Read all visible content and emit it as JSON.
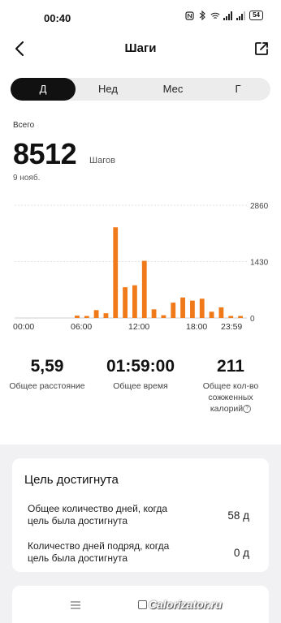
{
  "status_bar": {
    "time": "00:40",
    "battery": "54"
  },
  "header": {
    "title": "Шаги"
  },
  "tabs": [
    {
      "label": "Д",
      "active": true
    },
    {
      "label": "Нед",
      "active": false
    },
    {
      "label": "Мес",
      "active": false
    },
    {
      "label": "Г",
      "active": false
    }
  ],
  "summary": {
    "total_label": "Всего",
    "steps": "8512",
    "unit": "Шагов",
    "date": "9 нояб."
  },
  "chart_data": {
    "type": "bar",
    "accent_color": "#f07a1a",
    "x_tick_labels": [
      "00:00",
      "06:00",
      "12:00",
      "18:00",
      "23:59"
    ],
    "y_tick_labels": [
      "2860",
      "1430",
      "0"
    ],
    "ylim": [
      0,
      2860
    ],
    "hours": [
      0,
      1,
      2,
      3,
      4,
      5,
      6,
      7,
      8,
      9,
      10,
      11,
      12,
      13,
      14,
      15,
      16,
      17,
      18,
      19,
      20,
      21,
      22,
      23
    ],
    "values": [
      0,
      0,
      0,
      0,
      0,
      0,
      60,
      40,
      200,
      120,
      2300,
      780,
      830,
      1450,
      220,
      70,
      390,
      520,
      440,
      490,
      160,
      270,
      40,
      30
    ]
  },
  "stats": {
    "distance_value": "5,59",
    "distance_label": "Общее расстояние",
    "time_value": "01:59:00",
    "time_label": "Общее время",
    "calories_value": "211",
    "calories_label_1": "Общее кол-во",
    "calories_label_2": "сожженных",
    "calories_label_3": "калорий",
    "info_glyph": "?"
  },
  "goal": {
    "title": "Цель достигнута",
    "row1_label_1": "Общее количество дней, когда",
    "row1_label_2": "цель была достигнута",
    "row1_value": "58 д",
    "row2_label_1": "Количество дней подряд, когда",
    "row2_label_2": "цель была достигнута",
    "row2_value": "0 д"
  },
  "watermark": "Calorizator.ru"
}
